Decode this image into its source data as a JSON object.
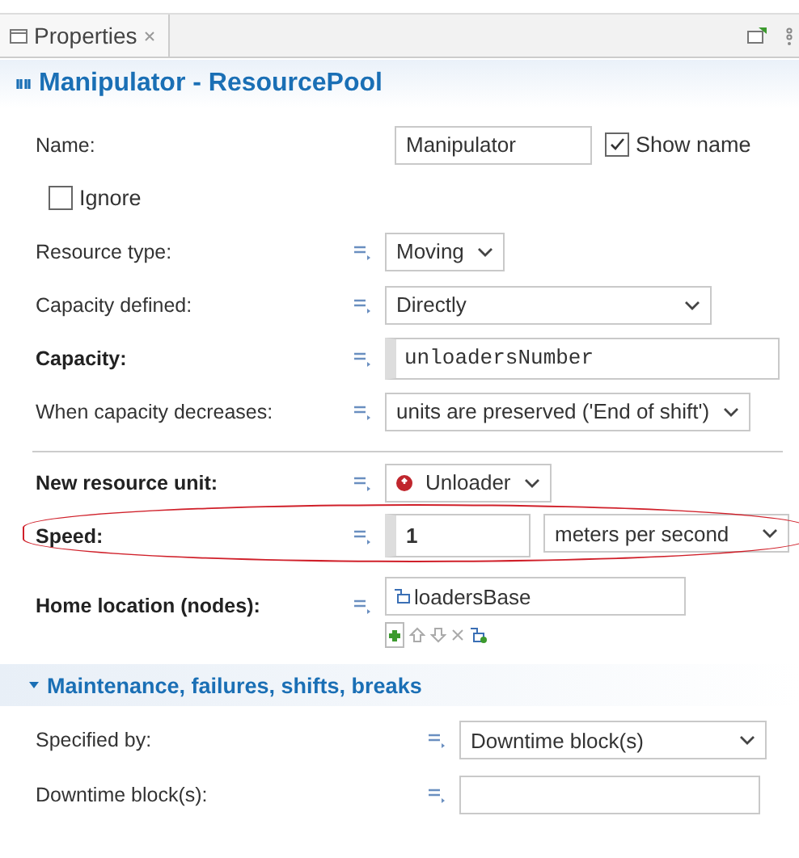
{
  "tab": {
    "label": "Properties"
  },
  "title": "Manipulator - ResourcePool",
  "rows": [
    {
      "kind": "name",
      "label": "Name:",
      "value": "Manipulator",
      "checkbox": {
        "label": "Show name",
        "checked": true
      }
    },
    {
      "kind": "checkbox",
      "label": "Ignore",
      "checked": false
    },
    {
      "kind": "select",
      "label": "Resource type:",
      "value": "Moving",
      "bold": false
    },
    {
      "kind": "select",
      "label": "Capacity defined:",
      "value": "Directly",
      "bold": false,
      "wide": true
    },
    {
      "kind": "code",
      "label": "Capacity:",
      "value": "unloadersNumber",
      "bold": true
    },
    {
      "kind": "select",
      "label": "When capacity decreases:",
      "value": "units are preserved ('End of shift')",
      "bold": false
    },
    {
      "kind": "agent",
      "label": "New resource unit:",
      "value": "Unloader",
      "bold": true,
      "divider_before": true
    },
    {
      "kind": "quantity",
      "label": "Speed:",
      "value": "1",
      "unit": "meters per second",
      "bold": true,
      "highlighted": true
    },
    {
      "kind": "list",
      "label": "Home location (nodes):",
      "value": "loadersBase",
      "bold": true
    }
  ],
  "section": {
    "title": "Maintenance, failures, shifts, breaks",
    "expanded": true,
    "rows": [
      {
        "kind": "select",
        "label": "Specified by:",
        "value": "Downtime block(s)",
        "bold": false,
        "wide": true
      },
      {
        "kind": "text",
        "label": "Downtime block(s):",
        "value": "",
        "bold": false
      }
    ]
  }
}
